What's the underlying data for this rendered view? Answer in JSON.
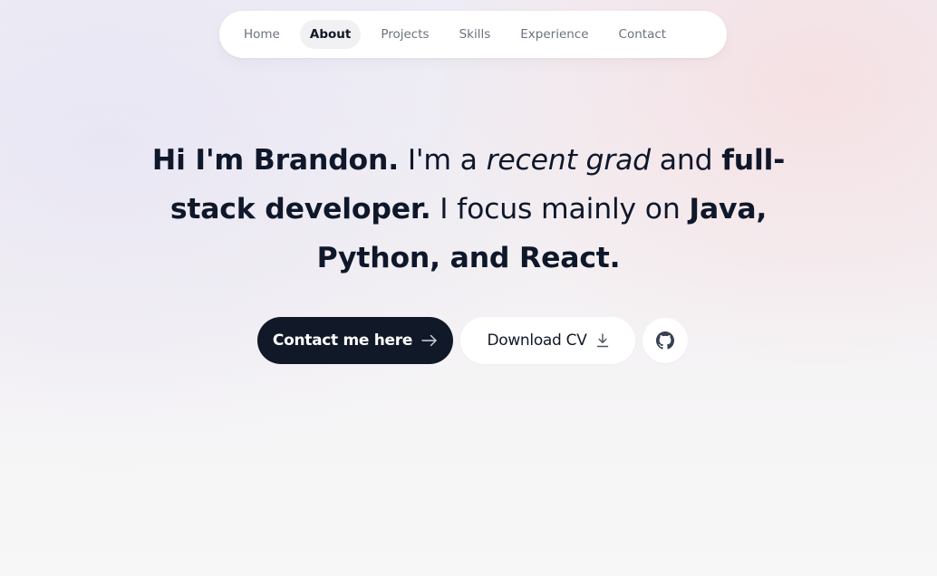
{
  "nav": {
    "items": [
      {
        "label": "Home",
        "active": false
      },
      {
        "label": "About",
        "active": true
      },
      {
        "label": "Projects",
        "active": false
      },
      {
        "label": "Skills",
        "active": false
      },
      {
        "label": "Experience",
        "active": false
      },
      {
        "label": "Contact",
        "active": false
      }
    ]
  },
  "hero": {
    "part1": "Hi I'm Brandon.",
    "part2": " I'm a ",
    "part3": "recent grad",
    "part4": " and ",
    "part5": "full-stack developer.",
    "part6": " I focus mainly on ",
    "part7": "Java, Python, and React."
  },
  "actions": {
    "contact_label": "Contact me here",
    "contact_icon": "arrow-right-icon",
    "download_label": "Download CV",
    "download_icon": "download-icon",
    "github_icon": "github-icon"
  },
  "colors": {
    "primary_button": "#111827",
    "nav_active_bg": "#f1f1f3",
    "nav_text": "#6b7280"
  }
}
